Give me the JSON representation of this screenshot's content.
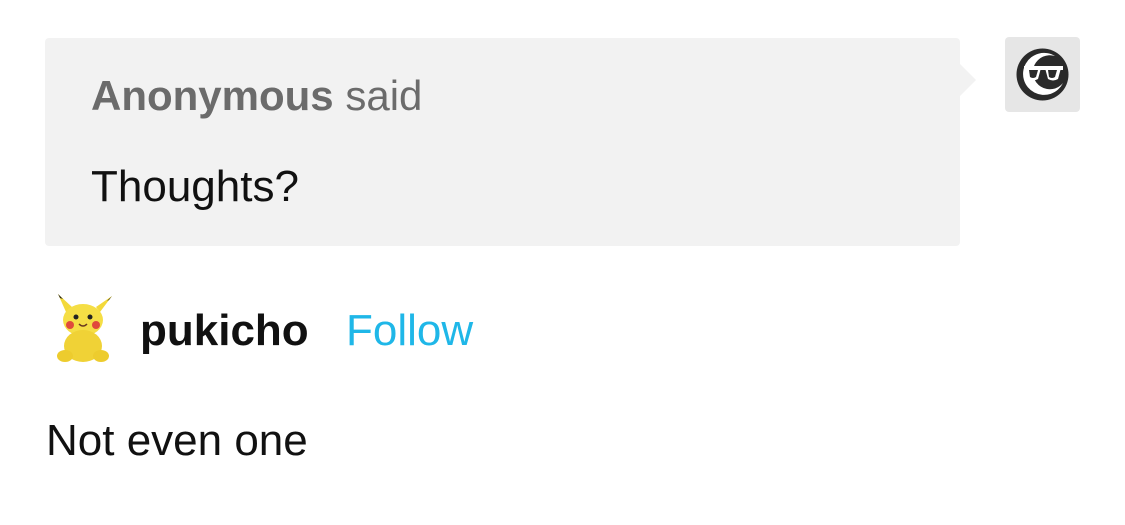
{
  "ask": {
    "asker_name": "Anonymous",
    "said_label": "said",
    "question": "Thoughts?",
    "asker_avatar_icon": "anonymous-sunglasses-icon"
  },
  "answer": {
    "author_name": "pukicho",
    "follow_label": "Follow",
    "author_avatar_icon": "pikachu-plush-avatar",
    "body": "Not even one"
  },
  "colors": {
    "bubble_background": "#f2f2f2",
    "follow_link": "#1fb7e8",
    "asker_text": "#6b6b6b",
    "primary_text": "#111111"
  }
}
